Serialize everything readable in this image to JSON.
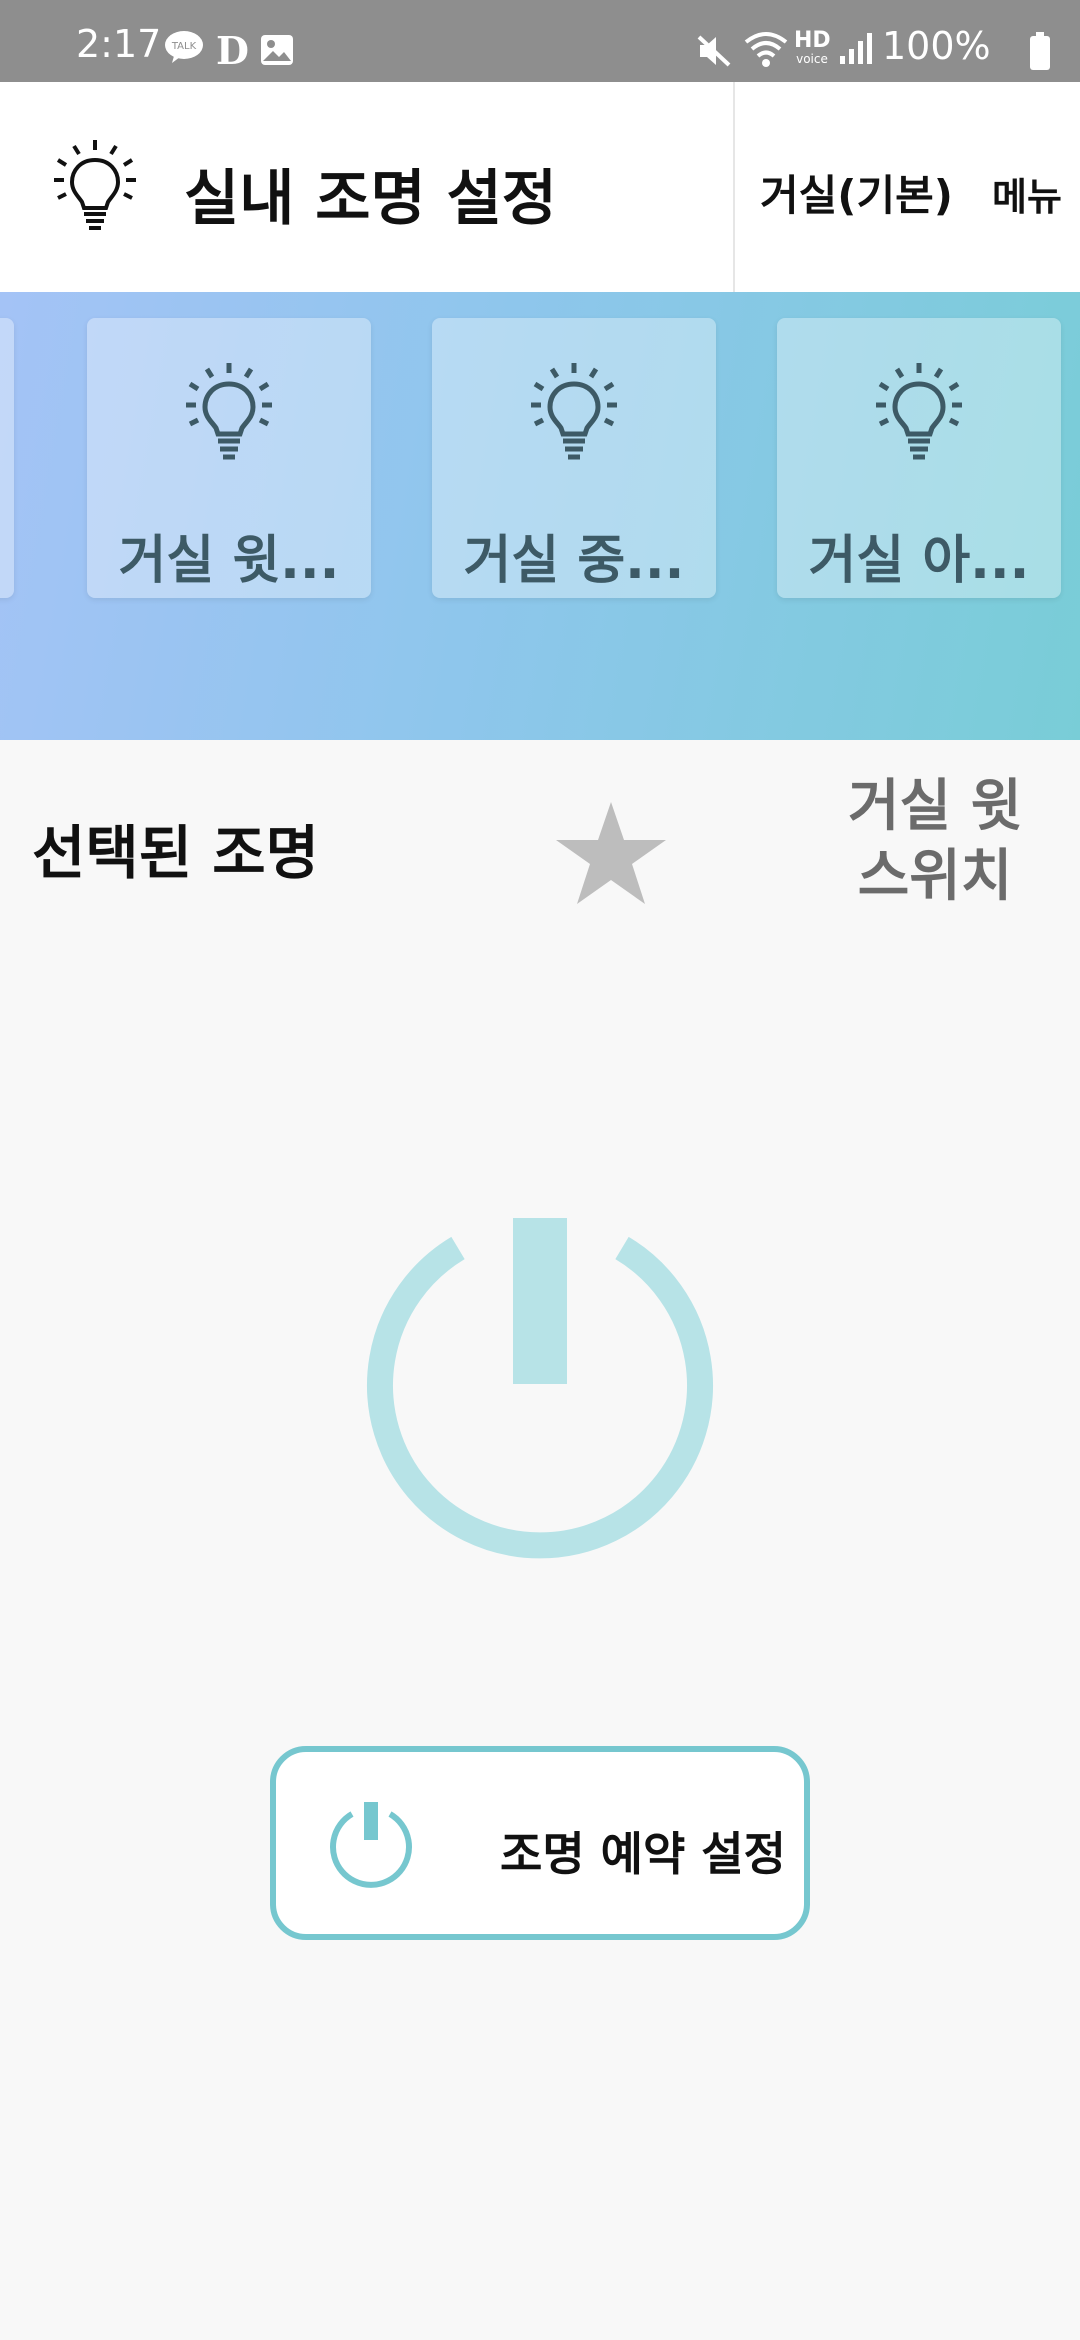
{
  "status_bar": {
    "time": "2:17",
    "left_icons": [
      "kakaotalk-icon",
      "d-app-icon",
      "gallery-icon"
    ],
    "right_icons": [
      "mute-icon",
      "wifi-icon",
      "hd-voice-icon",
      "signal-icon",
      "battery-icon"
    ],
    "battery": "100%",
    "hd_label": "HD",
    "voice_label": "voice",
    "talk_label": "TALK",
    "d_label": "D"
  },
  "app_bar": {
    "title": "실내 조명 설정",
    "room": "거실(기본)",
    "menu": "메뉴"
  },
  "lights": [
    {
      "label": "거실 윗..."
    },
    {
      "label": "거실 중..."
    },
    {
      "label": "거실 아..."
    }
  ],
  "selected": {
    "section_label": "선택된 조명",
    "name_line1": "거실 윗",
    "name_line2": "스위치"
  },
  "schedule": {
    "label": "조명 예약 설정"
  },
  "colors": {
    "accent": "#76c7cf",
    "power_faded": "#b7e3e7",
    "star": "#bdbdbd",
    "card_text": "#3d5a66"
  }
}
